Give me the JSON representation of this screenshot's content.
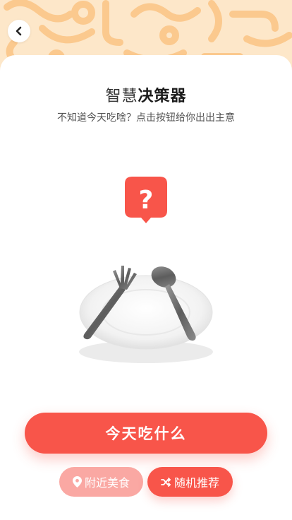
{
  "header": {
    "back_icon": "chevron-left-icon"
  },
  "page": {
    "title_light": "智慧",
    "title_bold": "决策器",
    "subtitle": "不知道今天吃啥？点击按钮给你出出主意"
  },
  "illustration": {
    "question_mark": "?",
    "accent_color": "#f8554a"
  },
  "actions": {
    "main_label": "今天吃什么",
    "nearby_label": "附近美食",
    "nearby_icon": "location-pin-icon",
    "random_label": "随机推荐",
    "random_icon": "shuffle-icon"
  },
  "colors": {
    "accent": "#f8554a",
    "accent_light": "#faa8a3",
    "header_bg": "#fde7c9",
    "pattern": "#fbc98e"
  }
}
